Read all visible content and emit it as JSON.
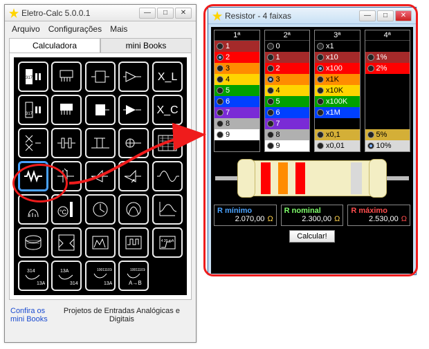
{
  "main_window": {
    "title": "Eletro-Calc  5.0.0.1",
    "menu": [
      "Arquivo",
      "Configurações",
      "Mais"
    ],
    "tabs": [
      "Calculadora",
      "mini Books"
    ],
    "footer_link": "Confira os\nmini Books",
    "footer_text": "Projetos de Entradas Analógicas e Digitais"
  },
  "min_btn": "—",
  "max_btn": "□",
  "close_btn": "✕",
  "resistor_window": {
    "title": "Resistor - 4 faixas",
    "band_heads": [
      "1ª",
      "2ª",
      "3ª",
      "4ª"
    ],
    "band1": [
      {
        "label": "1",
        "bg": "#a52a2a",
        "fg": "#fff"
      },
      {
        "label": "2",
        "bg": "#ff0000",
        "fg": "#fff",
        "sel": true
      },
      {
        "label": "3",
        "bg": "#ff8c00",
        "fg": "#000"
      },
      {
        "label": "4",
        "bg": "#ffd400",
        "fg": "#000"
      },
      {
        "label": "5",
        "bg": "#00a000",
        "fg": "#fff"
      },
      {
        "label": "6",
        "bg": "#0040ff",
        "fg": "#fff"
      },
      {
        "label": "7",
        "bg": "#7a2bd6",
        "fg": "#fff"
      },
      {
        "label": "8",
        "bg": "#b0b0b0",
        "fg": "#000"
      },
      {
        "label": "9",
        "bg": "#ffffff",
        "fg": "#000"
      }
    ],
    "band2": [
      {
        "label": "0",
        "bg": "#000000",
        "fg": "#fff"
      },
      {
        "label": "1",
        "bg": "#a52a2a",
        "fg": "#fff"
      },
      {
        "label": "2",
        "bg": "#ff0000",
        "fg": "#fff"
      },
      {
        "label": "3",
        "bg": "#ff8c00",
        "fg": "#000",
        "sel": true
      },
      {
        "label": "4",
        "bg": "#ffd400",
        "fg": "#000"
      },
      {
        "label": "5",
        "bg": "#00a000",
        "fg": "#fff"
      },
      {
        "label": "6",
        "bg": "#0040ff",
        "fg": "#fff"
      },
      {
        "label": "7",
        "bg": "#7a2bd6",
        "fg": "#fff"
      },
      {
        "label": "8",
        "bg": "#b0b0b0",
        "fg": "#000"
      },
      {
        "label": "9",
        "bg": "#ffffff",
        "fg": "#000"
      }
    ],
    "band3": [
      {
        "label": "x1",
        "bg": "#000000",
        "fg": "#fff"
      },
      {
        "label": "x10",
        "bg": "#a52a2a",
        "fg": "#fff"
      },
      {
        "label": "x100",
        "bg": "#ff0000",
        "fg": "#fff",
        "sel": true
      },
      {
        "label": "x1K",
        "bg": "#ff8c00",
        "fg": "#000"
      },
      {
        "label": "x10K",
        "bg": "#ffd400",
        "fg": "#000"
      },
      {
        "label": "x100K",
        "bg": "#00a000",
        "fg": "#fff"
      },
      {
        "label": "x1M",
        "bg": "#0040ff",
        "fg": "#fff"
      },
      {
        "label": "",
        "bg": "#000",
        "fg": "#fff"
      },
      {
        "label": "x0,1",
        "bg": "#d4af37",
        "fg": "#000"
      },
      {
        "label": "x0,01",
        "bg": "#d9d9d9",
        "fg": "#000"
      }
    ],
    "band4": [
      {
        "label": "",
        "bg": "#000",
        "fg": "#fff"
      },
      {
        "label": "1%",
        "bg": "#a52a2a",
        "fg": "#fff"
      },
      {
        "label": "2%",
        "bg": "#ff0000",
        "fg": "#fff"
      },
      {
        "label": "",
        "bg": "#000",
        "fg": "#fff"
      },
      {
        "label": "",
        "bg": "#000",
        "fg": "#fff"
      },
      {
        "label": "",
        "bg": "#000",
        "fg": "#fff"
      },
      {
        "label": "",
        "bg": "#000",
        "fg": "#fff"
      },
      {
        "label": "",
        "bg": "#000",
        "fg": "#fff"
      },
      {
        "label": "5%",
        "bg": "#d4af37",
        "fg": "#000"
      },
      {
        "label": "10%",
        "bg": "#d9d9d9",
        "fg": "#000",
        "sel": true
      }
    ],
    "stripe_colors": [
      "#ff0000",
      "#ff8c00",
      "#ff0000",
      "#d9d9d9"
    ],
    "results": {
      "min_label": "R mínimo",
      "min_val": "2.070,00",
      "nom_label": "R nominal",
      "nom_val": "2.300,00",
      "max_label": "R máximo",
      "max_val": "2.530,00",
      "ohm": "Ω"
    },
    "calc_btn": "Calcular!"
  }
}
